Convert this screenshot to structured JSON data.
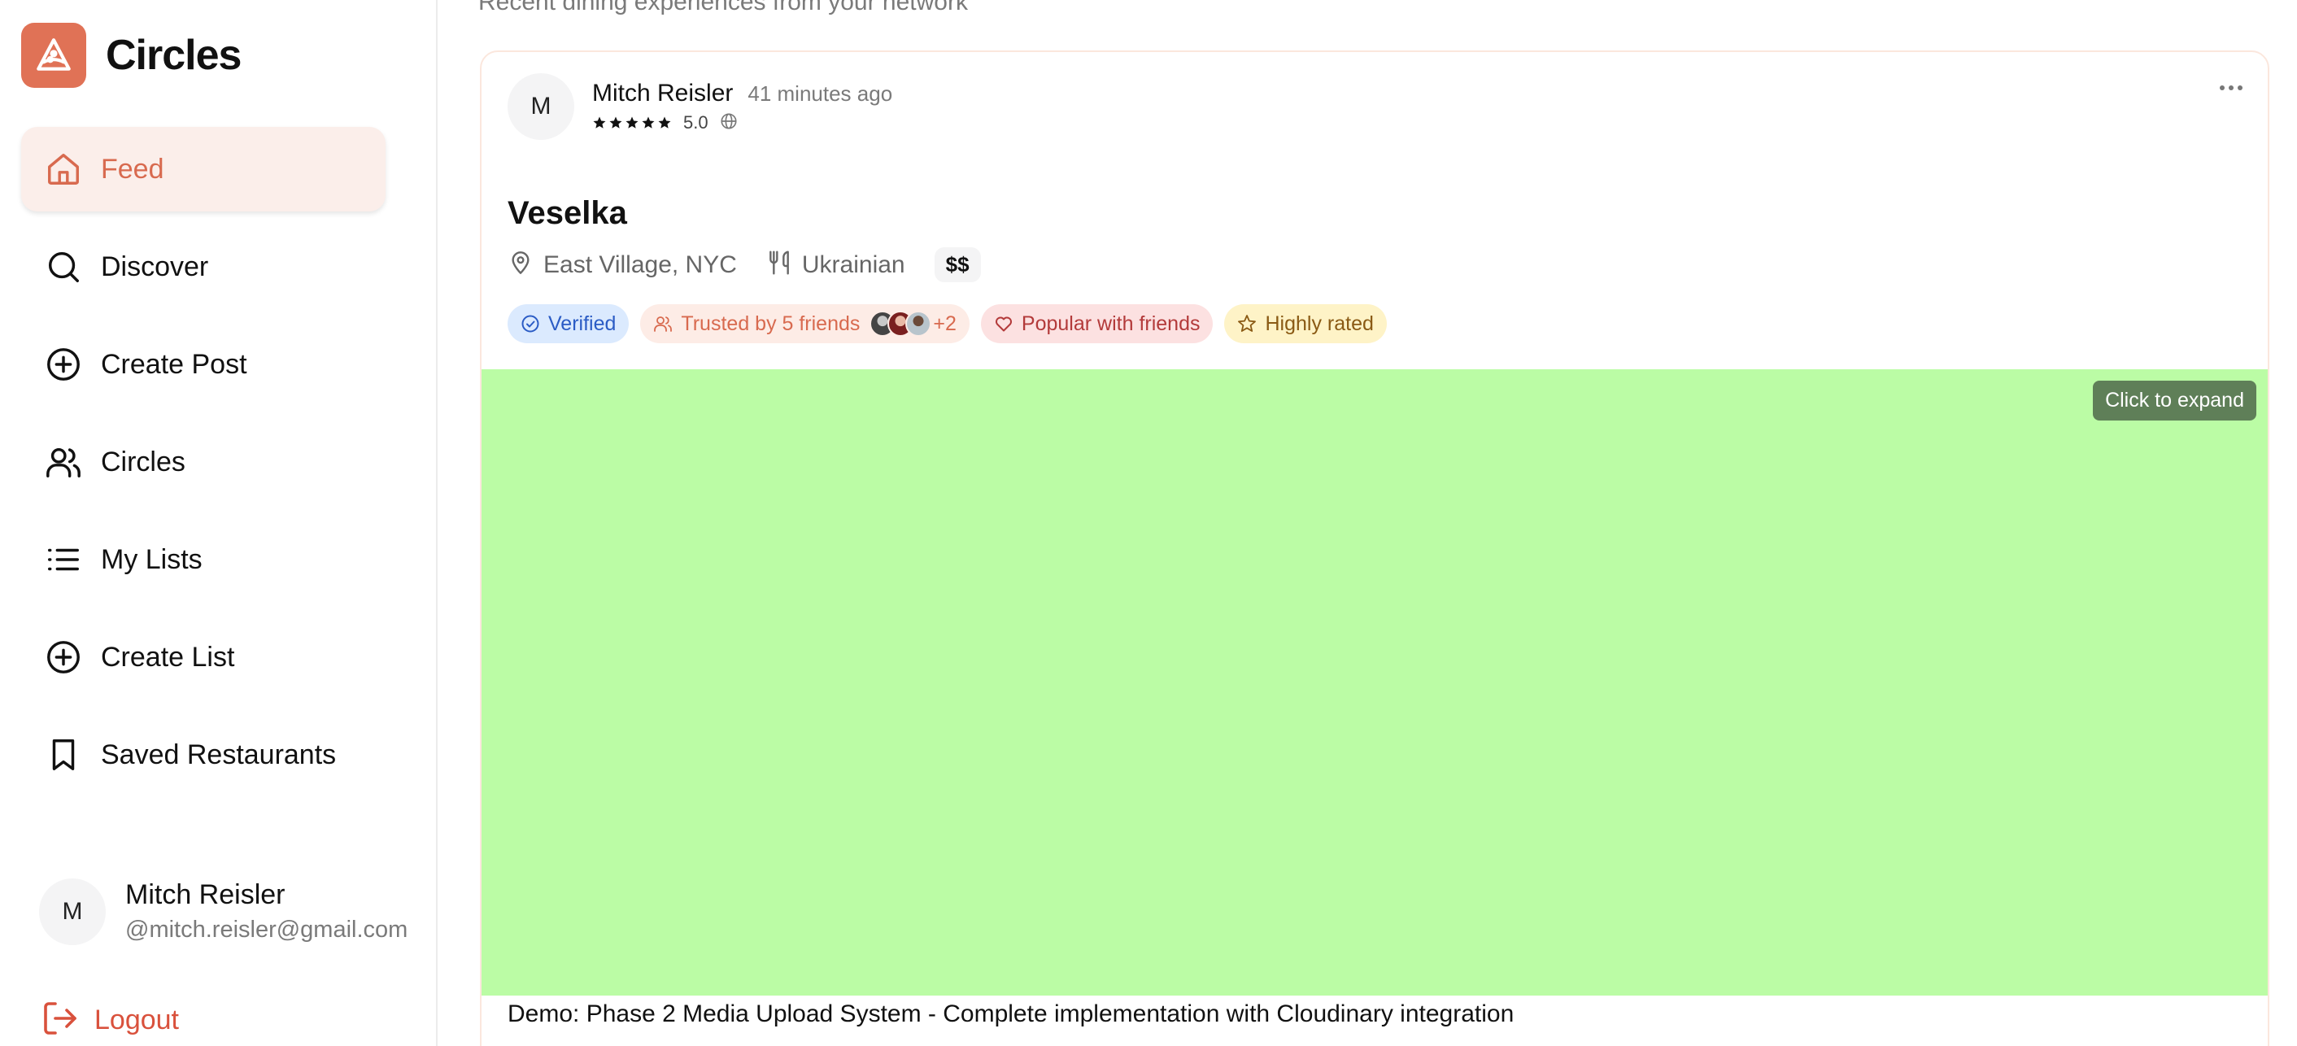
{
  "app": {
    "name": "Circles",
    "logo_icon": "pizza-slice-icon",
    "accent": "#e07256"
  },
  "sidebar": {
    "items": [
      {
        "label": "Feed",
        "icon": "home-icon",
        "active": true
      },
      {
        "label": "Discover",
        "icon": "search-icon"
      },
      {
        "label": "Create Post",
        "icon": "plus-circle-icon"
      },
      {
        "label": "Circles",
        "icon": "users-icon"
      },
      {
        "label": "My Lists",
        "icon": "list-icon"
      },
      {
        "label": "Create List",
        "icon": "plus-circle-icon"
      },
      {
        "label": "Saved Restaurants",
        "icon": "bookmark-icon"
      }
    ],
    "profile": {
      "initial": "M",
      "name": "Mitch Reisler",
      "email": "@mitch.reisler@gmail.com"
    },
    "logout_label": "Logout"
  },
  "main": {
    "subtitle": "Recent dining experiences from your network",
    "post": {
      "author_initial": "M",
      "author": "Mitch Reisler",
      "time": "41 minutes ago",
      "stars": 5,
      "rating": "5.0",
      "visibility_icon": "globe-icon",
      "restaurant": "Veselka",
      "location": "East Village, NYC",
      "cuisine": "Ukrainian",
      "price": "$$",
      "badges": {
        "verified": "Verified",
        "trusted": "Trusted by 5 friends",
        "trusted_more": "+2",
        "popular": "Popular with friends",
        "highly_rated": "Highly rated"
      },
      "media_color": "#bbfca5",
      "expand_label": "Click to expand",
      "caption": "Demo: Phase 2 Media Upload System - Complete implementation with Cloudinary integration"
    }
  }
}
